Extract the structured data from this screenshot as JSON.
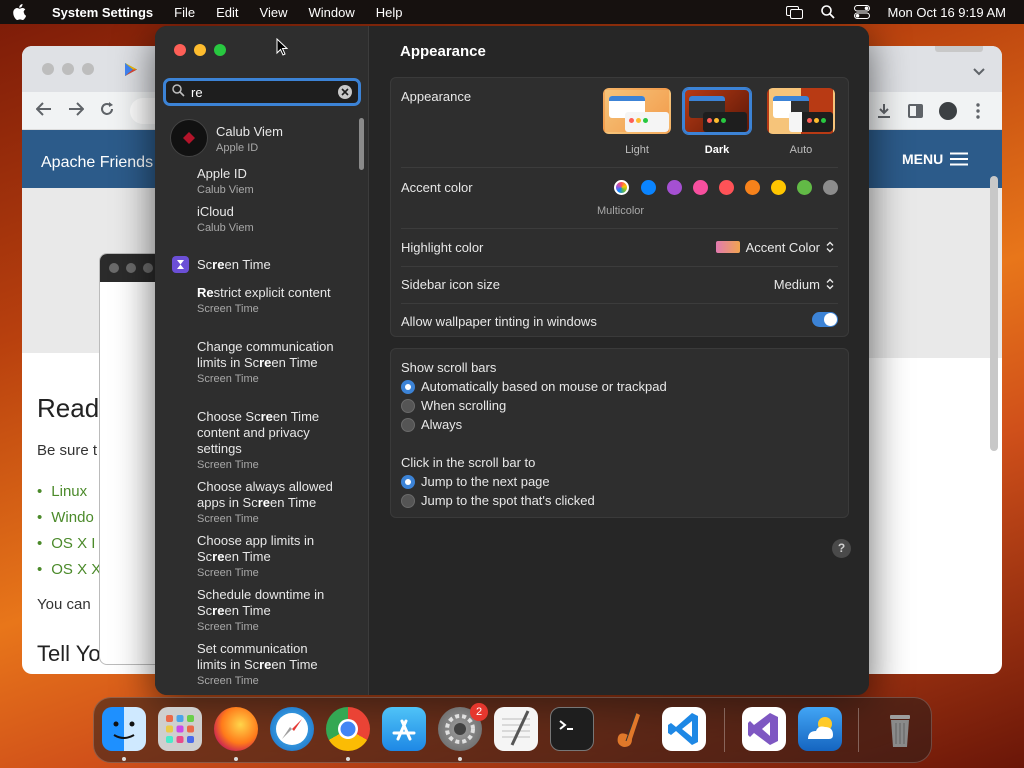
{
  "menubar": {
    "app_name": "System Settings",
    "items": [
      "File",
      "Edit",
      "View",
      "Window",
      "Help"
    ],
    "clock": "Mon Oct 16  9:19 AM"
  },
  "browser": {
    "site_title": "Apache Friends",
    "menu_label": "MENU",
    "heading": "Readi",
    "para": "Be sure t",
    "list": [
      "Linux",
      "Windo",
      "OS X I",
      "OS X X"
    ],
    "para2": "You can",
    "heading2": "Tell Your"
  },
  "sidebar": {
    "search_value": "re",
    "account": {
      "name": "Calub Viem",
      "sub": "Apple ID"
    },
    "results": [
      {
        "title": "Apple ID",
        "sub": "Calub Viem"
      },
      {
        "title": "iCloud",
        "sub": "Calub Viem"
      }
    ],
    "section": "Screen Time",
    "section_results": [
      {
        "title": "Restrict explicit content",
        "sub": "Screen Time"
      },
      {
        "title": "Change communication limits in Screen Time",
        "sub": "Screen Time"
      },
      {
        "title": "Choose Screen Time content and privacy settings",
        "sub": "Screen Time"
      },
      {
        "title": "Choose always allowed apps in Screen Time",
        "sub": "Screen Time"
      },
      {
        "title": "Choose app limits in Screen Time",
        "sub": "Screen Time"
      },
      {
        "title": "Schedule downtime in Screen Time",
        "sub": "Screen Time"
      },
      {
        "title": "Set communication limits in Screen Time",
        "sub": "Screen Time"
      }
    ]
  },
  "main": {
    "title": "Appearance",
    "appearance": {
      "label": "Appearance",
      "options": [
        "Light",
        "Dark",
        "Auto"
      ],
      "selected": "Dark"
    },
    "accent": {
      "label": "Accent color",
      "selected_name": "Multicolor",
      "colors": [
        "#0a84ff",
        "#a550d2",
        "#f74f9e",
        "#ff5257",
        "#f7821b",
        "#ffc600",
        "#62ba46",
        "#8c8c8c"
      ]
    },
    "highlight": {
      "label": "Highlight color",
      "value": "Accent Color"
    },
    "icon_size": {
      "label": "Sidebar icon size",
      "value": "Medium"
    },
    "tinting": {
      "label": "Allow wallpaper tinting in windows",
      "on": true
    },
    "scrollbars": {
      "label": "Show scroll bars",
      "options": [
        "Automatically based on mouse or trackpad",
        "When scrolling",
        "Always"
      ],
      "selected": 0
    },
    "click_scroll": {
      "label": "Click in the scroll bar to",
      "options": [
        "Jump to the next page",
        "Jump to the spot that's clicked"
      ],
      "selected": 0
    },
    "help": "?"
  },
  "dock": {
    "apps": [
      "Finder",
      "Launchpad",
      "Firefox",
      "Safari",
      "Chrome",
      "App Store",
      "System Settings",
      "TextEdit",
      "Terminal",
      "GarageBand",
      "Visual Studio Code",
      "Visual Studio",
      "Weather",
      "Trash"
    ],
    "badge": "2"
  }
}
